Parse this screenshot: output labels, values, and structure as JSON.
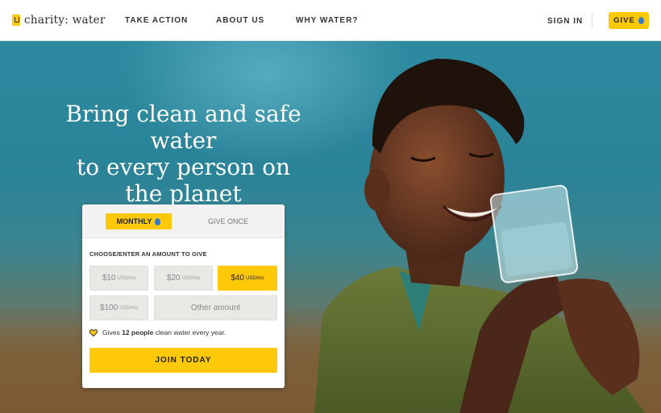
{
  "header": {
    "logo_text": "charity: water",
    "nav": [
      "TAKE ACTION",
      "ABOUT US",
      "WHY WATER?"
    ],
    "sign_in": "SIGN IN",
    "give": "GIVE"
  },
  "hero": {
    "headline_lines": [
      "Bring clean and safe water",
      "to every person on",
      "the planet"
    ]
  },
  "donation": {
    "tabs": {
      "monthly": "MONTHLY",
      "once": "GIVE ONCE",
      "active": "monthly"
    },
    "choose_label": "CHOOSE/ENTER AN AMOUNT TO GIVE",
    "amounts": [
      {
        "value": "$10",
        "unit": "USD/mo",
        "selected": false
      },
      {
        "value": "$20",
        "unit": "USD/mo",
        "selected": false
      },
      {
        "value": "$40",
        "unit": "USD/mo",
        "selected": true
      },
      {
        "value": "$100",
        "unit": "USD/mo",
        "selected": false
      }
    ],
    "other_placeholder": "Other amount",
    "impact_prefix": "Gives",
    "impact_bold": "12 people",
    "impact_suffix": "clean water every year.",
    "join": "JOIN TODAY"
  },
  "colors": {
    "accent": "#ffc907",
    "drop": "#3b7bbf",
    "sky": "#2d8aa0"
  },
  "icons": [
    "water-drop-icon",
    "heart-icon",
    "logo-jerrycan-icon"
  ]
}
